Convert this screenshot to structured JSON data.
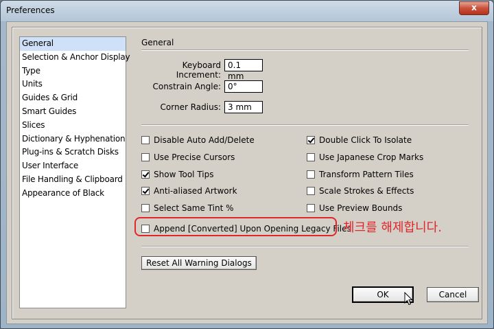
{
  "window": {
    "title": "Preferences",
    "close_glyph": "x"
  },
  "sidebar": {
    "items": [
      {
        "label": "General",
        "selected": true
      },
      {
        "label": "Selection & Anchor Display"
      },
      {
        "label": "Type"
      },
      {
        "label": "Units"
      },
      {
        "label": "Guides & Grid"
      },
      {
        "label": "Smart Guides"
      },
      {
        "label": "Slices"
      },
      {
        "label": "Dictionary & Hyphenation"
      },
      {
        "label": "Plug-ins & Scratch Disks"
      },
      {
        "label": "User Interface"
      },
      {
        "label": "File Handling & Clipboard"
      },
      {
        "label": "Appearance of Black"
      }
    ]
  },
  "general": {
    "title": "General",
    "keyboard_increment": {
      "label": "Keyboard Increment:",
      "value": "0.1 mm"
    },
    "constrain_angle": {
      "label": "Constrain Angle:",
      "value": "0°"
    },
    "corner_radius": {
      "label": "Corner Radius:",
      "value": "3 mm"
    }
  },
  "options": {
    "disable_auto_add": {
      "label": "Disable Auto Add/Delete",
      "checked": false
    },
    "precise_cursors": {
      "label": "Use Precise Cursors",
      "checked": false
    },
    "tool_tips": {
      "label": "Show Tool Tips",
      "checked": true
    },
    "anti_aliased": {
      "label": "Anti-aliased Artwork",
      "checked": true
    },
    "same_tint": {
      "label": "Select Same Tint %",
      "checked": false
    },
    "double_click_isolate": {
      "label": "Double Click To Isolate",
      "checked": true
    },
    "japanese_crop": {
      "label": "Use Japanese Crop Marks",
      "checked": false
    },
    "transform_pattern": {
      "label": "Transform Pattern Tiles",
      "checked": false
    },
    "scale_strokes": {
      "label": "Scale Strokes & Effects",
      "checked": false
    },
    "preview_bounds": {
      "label": "Use Preview Bounds",
      "checked": false
    },
    "append_converted": {
      "label": "Append [Converted] Upon Opening Legacy Files",
      "checked": false
    }
  },
  "annotation": {
    "text": "체크를 해제합니다.",
    "color": "#e0262b"
  },
  "buttons": {
    "reset_warnings": "Reset All Warning Dialogs",
    "ok": "OK",
    "cancel": "Cancel"
  }
}
